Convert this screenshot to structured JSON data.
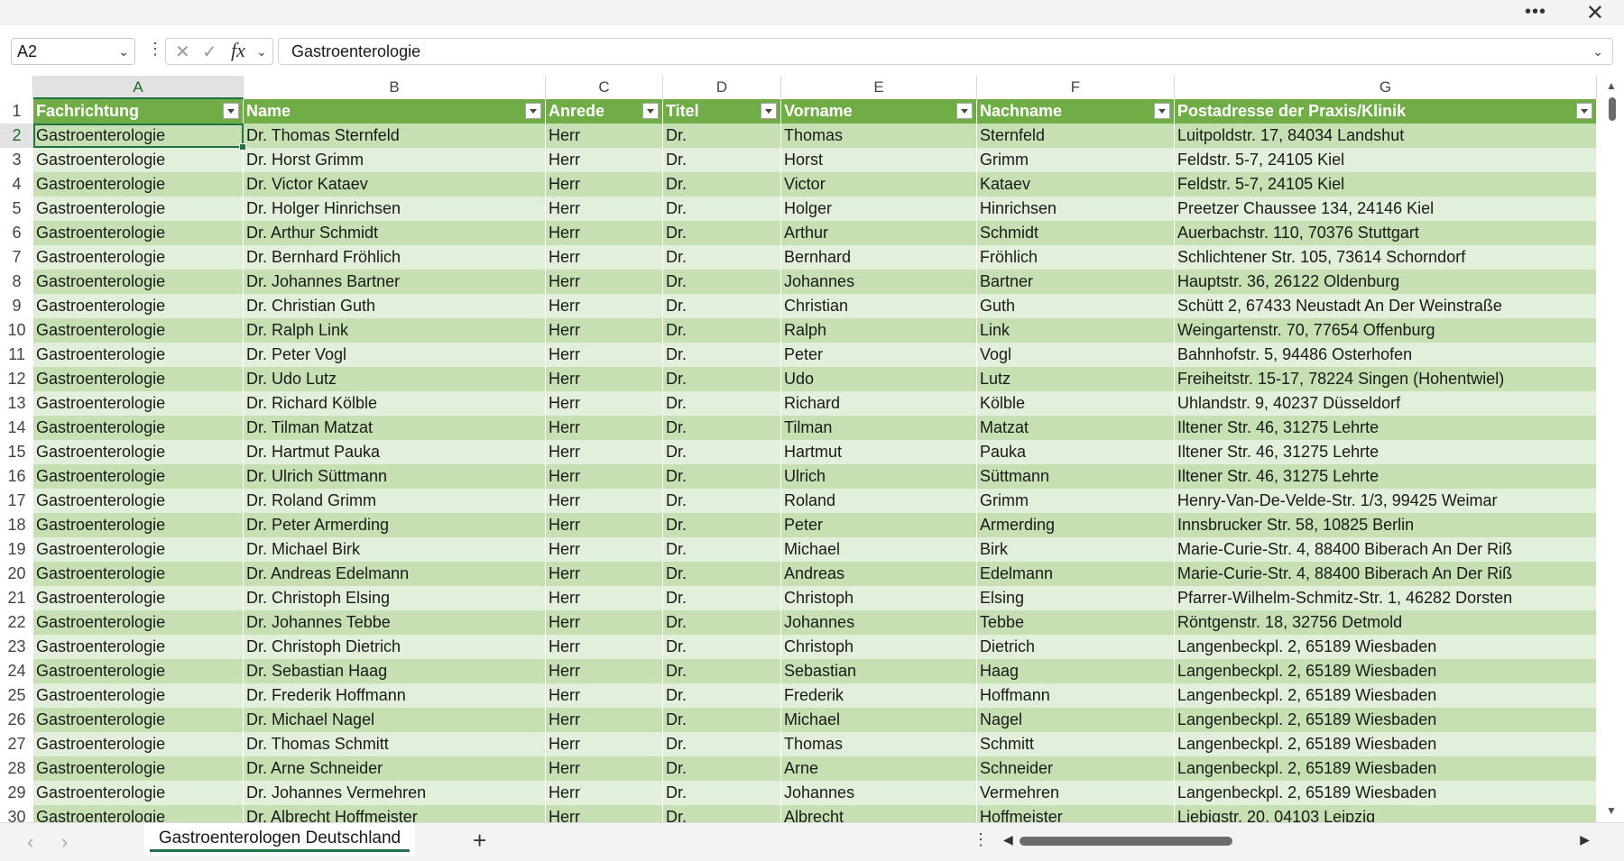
{
  "formula_bar": {
    "name_box": "A2",
    "formula": "Gastroenterologie",
    "fx_label": "fx"
  },
  "columns": [
    "A",
    "B",
    "C",
    "D",
    "E",
    "F",
    "G"
  ],
  "header": [
    "Fachrichtung",
    "Name",
    "Anrede",
    "Titel",
    "Vorname",
    "Nachname",
    "Postadresse der Praxis/Klinik"
  ],
  "rows": [
    [
      "Gastroenterologie",
      "Dr. Thomas Sternfeld",
      "Herr",
      "Dr.",
      "Thomas",
      "Sternfeld",
      "Luitpoldstr. 17, 84034 Landshut"
    ],
    [
      "Gastroenterologie",
      "Dr. Horst Grimm",
      "Herr",
      "Dr.",
      "Horst",
      "Grimm",
      "Feldstr. 5-7, 24105 Kiel"
    ],
    [
      "Gastroenterologie",
      "Dr. Victor Kataev",
      "Herr",
      "Dr.",
      "Victor",
      "Kataev",
      "Feldstr. 5-7, 24105 Kiel"
    ],
    [
      "Gastroenterologie",
      "Dr. Holger Hinrichsen",
      "Herr",
      "Dr.",
      "Holger",
      "Hinrichsen",
      "Preetzer Chaussee 134, 24146 Kiel"
    ],
    [
      "Gastroenterologie",
      "Dr. Arthur Schmidt",
      "Herr",
      "Dr.",
      "Arthur",
      "Schmidt",
      "Auerbachstr. 110, 70376 Stuttgart"
    ],
    [
      "Gastroenterologie",
      "Dr. Bernhard Fröhlich",
      "Herr",
      "Dr.",
      "Bernhard",
      "Fröhlich",
      "Schlichtener Str. 105, 73614 Schorndorf"
    ],
    [
      "Gastroenterologie",
      "Dr. Johannes Bartner",
      "Herr",
      "Dr.",
      "Johannes",
      "Bartner",
      "Hauptstr. 36, 26122 Oldenburg"
    ],
    [
      "Gastroenterologie",
      "Dr. Christian Guth",
      "Herr",
      "Dr.",
      "Christian",
      "Guth",
      "Schütt 2, 67433 Neustadt An Der Weinstraße"
    ],
    [
      "Gastroenterologie",
      "Dr. Ralph Link",
      "Herr",
      "Dr.",
      "Ralph",
      "Link",
      "Weingartenstr. 70, 77654 Offenburg"
    ],
    [
      "Gastroenterologie",
      "Dr. Peter Vogl",
      "Herr",
      "Dr.",
      "Peter",
      "Vogl",
      "Bahnhofstr. 5, 94486 Osterhofen"
    ],
    [
      "Gastroenterologie",
      "Dr. Udo Lutz",
      "Herr",
      "Dr.",
      "Udo",
      "Lutz",
      "Freiheitstr. 15-17, 78224 Singen (Hohentwiel)"
    ],
    [
      "Gastroenterologie",
      "Dr. Richard Kölble",
      "Herr",
      "Dr.",
      "Richard",
      "Kölble",
      "Uhlandstr. 9, 40237 Düsseldorf"
    ],
    [
      "Gastroenterologie",
      "Dr. Tilman Matzat",
      "Herr",
      "Dr.",
      "Tilman",
      "Matzat",
      "Iltener Str. 46, 31275 Lehrte"
    ],
    [
      "Gastroenterologie",
      "Dr. Hartmut Pauka",
      "Herr",
      "Dr.",
      "Hartmut",
      "Pauka",
      "Iltener Str. 46, 31275 Lehrte"
    ],
    [
      "Gastroenterologie",
      "Dr. Ulrich Süttmann",
      "Herr",
      "Dr.",
      "Ulrich",
      "Süttmann",
      "Iltener Str. 46, 31275 Lehrte"
    ],
    [
      "Gastroenterologie",
      "Dr. Roland Grimm",
      "Herr",
      "Dr.",
      "Roland",
      "Grimm",
      "Henry-Van-De-Velde-Str. 1/3, 99425 Weimar"
    ],
    [
      "Gastroenterologie",
      "Dr. Peter Armerding",
      "Herr",
      "Dr.",
      "Peter",
      "Armerding",
      "Innsbrucker Str. 58, 10825 Berlin"
    ],
    [
      "Gastroenterologie",
      "Dr. Michael Birk",
      "Herr",
      "Dr.",
      "Michael",
      "Birk",
      "Marie-Curie-Str. 4, 88400 Biberach An Der Riß"
    ],
    [
      "Gastroenterologie",
      "Dr. Andreas Edelmann",
      "Herr",
      "Dr.",
      "Andreas",
      "Edelmann",
      "Marie-Curie-Str. 4, 88400 Biberach An Der Riß"
    ],
    [
      "Gastroenterologie",
      "Dr. Christoph Elsing",
      "Herr",
      "Dr.",
      "Christoph",
      "Elsing",
      "Pfarrer-Wilhelm-Schmitz-Str. 1, 46282 Dorsten"
    ],
    [
      "Gastroenterologie",
      "Dr. Johannes Tebbe",
      "Herr",
      "Dr.",
      "Johannes",
      "Tebbe",
      "Röntgenstr. 18, 32756 Detmold"
    ],
    [
      "Gastroenterologie",
      "Dr. Christoph Dietrich",
      "Herr",
      "Dr.",
      "Christoph",
      "Dietrich",
      "Langenbeckpl. 2, 65189 Wiesbaden"
    ],
    [
      "Gastroenterologie",
      "Dr. Sebastian Haag",
      "Herr",
      "Dr.",
      "Sebastian",
      "Haag",
      "Langenbeckpl. 2, 65189 Wiesbaden"
    ],
    [
      "Gastroenterologie",
      "Dr. Frederik Hoffmann",
      "Herr",
      "Dr.",
      "Frederik",
      "Hoffmann",
      "Langenbeckpl. 2, 65189 Wiesbaden"
    ],
    [
      "Gastroenterologie",
      "Dr. Michael Nagel",
      "Herr",
      "Dr.",
      "Michael",
      "Nagel",
      "Langenbeckpl. 2, 65189 Wiesbaden"
    ],
    [
      "Gastroenterologie",
      "Dr. Thomas Schmitt",
      "Herr",
      "Dr.",
      "Thomas",
      "Schmitt",
      "Langenbeckpl. 2, 65189 Wiesbaden"
    ],
    [
      "Gastroenterologie",
      "Dr. Arne Schneider",
      "Herr",
      "Dr.",
      "Arne",
      "Schneider",
      "Langenbeckpl. 2, 65189 Wiesbaden"
    ],
    [
      "Gastroenterologie",
      "Dr. Johannes Vermehren",
      "Herr",
      "Dr.",
      "Johannes",
      "Vermehren",
      "Langenbeckpl. 2, 65189 Wiesbaden"
    ],
    [
      "Gastroenterologie",
      "Dr. Albrecht Hoffmeister",
      "Herr",
      "Dr.",
      "Albrecht",
      "Hoffmeister",
      "Liebigstr. 20, 04103 Leipzig"
    ]
  ],
  "selected_cell": {
    "row": 2,
    "col": "A"
  },
  "sheet_tab": "Gastroenterologen Deutschland",
  "colors": {
    "header": "#70ad47",
    "band_dark": "#c6e0b4",
    "band_light": "#e2efda",
    "accent": "#217346"
  }
}
